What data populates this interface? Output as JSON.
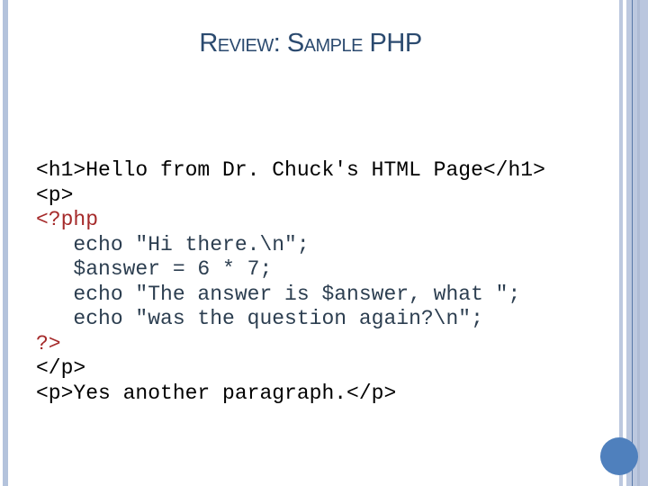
{
  "slide": {
    "title": "Review: Sample PHP",
    "colors": {
      "title": "#2b4a6f",
      "php_delimiter": "#a52a2a",
      "php_statement": "#2c3e50",
      "accent_circle": "#4f80bd",
      "border_stripe": "#b4c3dc"
    },
    "code_lines": [
      {
        "text": "<h1>Hello from Dr. Chuck's HTML Page</h1>",
        "kind": "html"
      },
      {
        "text": "<p>",
        "kind": "html"
      },
      {
        "text": "<?php",
        "kind": "php-tag"
      },
      {
        "text": "   echo \"Hi there.\\n\";",
        "kind": "php-body"
      },
      {
        "text": "   $answer = 6 * 7;",
        "kind": "php-body"
      },
      {
        "text": "   echo \"The answer is $answer, what \";",
        "kind": "php-body"
      },
      {
        "text": "   echo \"was the question again?\\n\";",
        "kind": "php-body"
      },
      {
        "text": "?>",
        "kind": "php-tag"
      },
      {
        "text": "</p>",
        "kind": "html"
      },
      {
        "text": "<p>Yes another paragraph.</p>",
        "kind": "html"
      }
    ]
  }
}
